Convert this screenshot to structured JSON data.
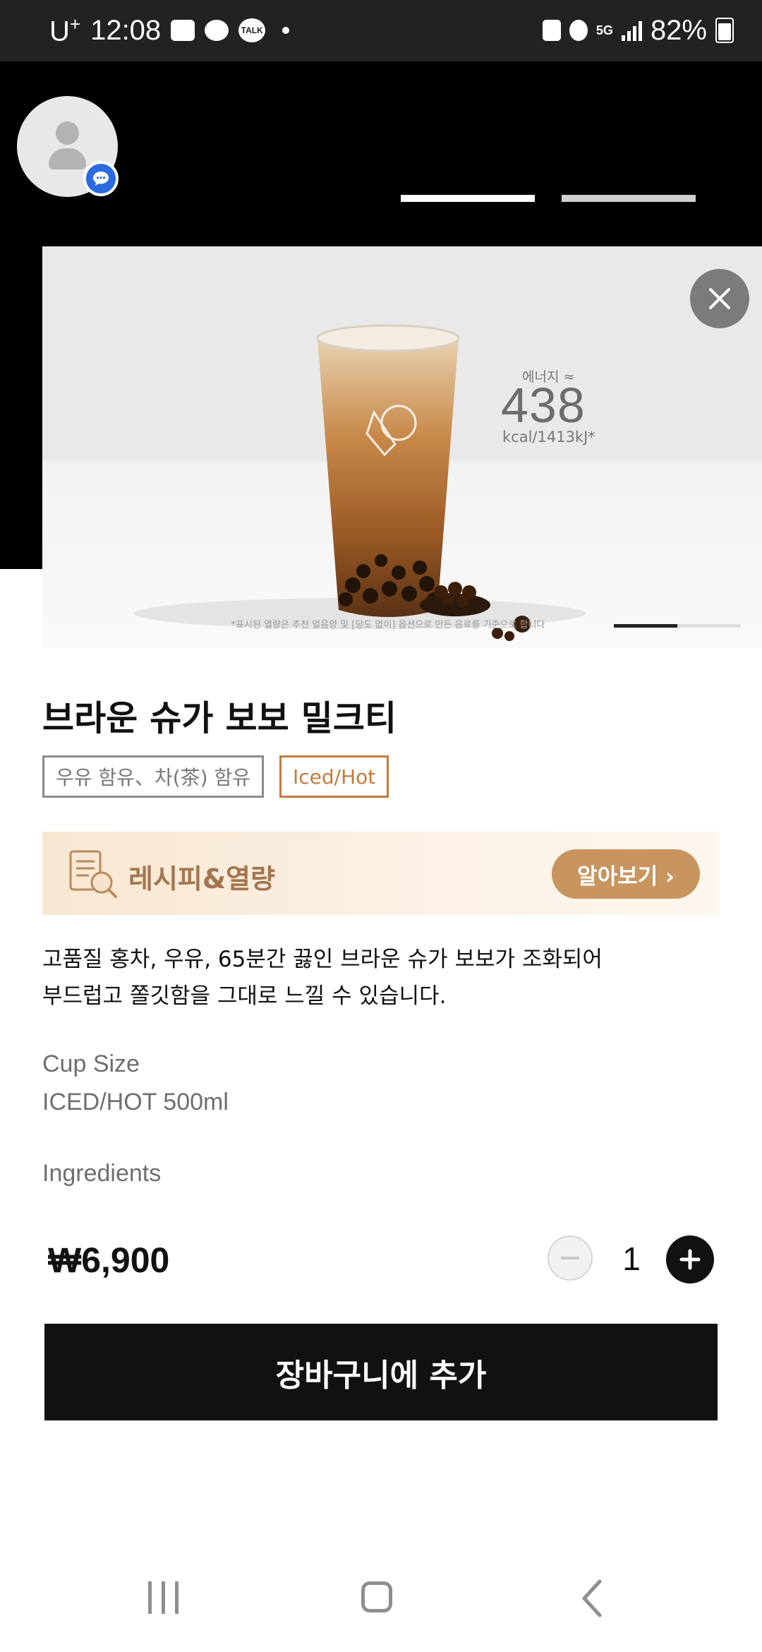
{
  "status_bar": {
    "carrier": "U",
    "carrier_sup": "+",
    "time": "12:08",
    "network": "5G",
    "battery": "82%",
    "icons": [
      "gallery-icon",
      "weather-icon",
      "kakaotalk-icon",
      "notification-dot",
      "battery-saver-icon",
      "alarm-icon",
      "5g-icon",
      "signal-icon",
      "battery-icon"
    ],
    "talk_badge": "TALK"
  },
  "hero": {
    "energy_label": "에너지 ≈",
    "energy_value": "438",
    "energy_unit": "kcal/1413kJ*",
    "disclaimer": "*표시된 열량은 추천 얼음양 및 [당도 없이] 옵션으로 만든 음료를 기준으로 합니다",
    "carousel_position": 0.5
  },
  "product": {
    "title": "브라운 슈가 보보 밀크티",
    "tags": [
      "우유 함유、차(茶) 함유",
      "Iced/Hot"
    ],
    "description_lines": [
      "고품질 홍차, 우유, 65분간 끓인 브라운 슈가 보보가 조화되어",
      "부드럽고 쫄깃함을 그대로 느낄 수 있습니다."
    ],
    "cup_size_label": "Cup Size",
    "cup_size_value": "ICED/HOT 500ml",
    "ingredients_label": "Ingredients",
    "price": "₩6,900",
    "quantity": "1"
  },
  "recipe_banner": {
    "title": "레시피&열량",
    "button_label": "알아보기 ›"
  },
  "cart_button": {
    "label": "장바구니에 추가"
  },
  "colors": {
    "accent_tag": "#c47a3a",
    "banner_button": "#c8955f",
    "banner_text": "#a2764f",
    "primary_button": "#111111",
    "chat_badge": "#2a6be0"
  }
}
